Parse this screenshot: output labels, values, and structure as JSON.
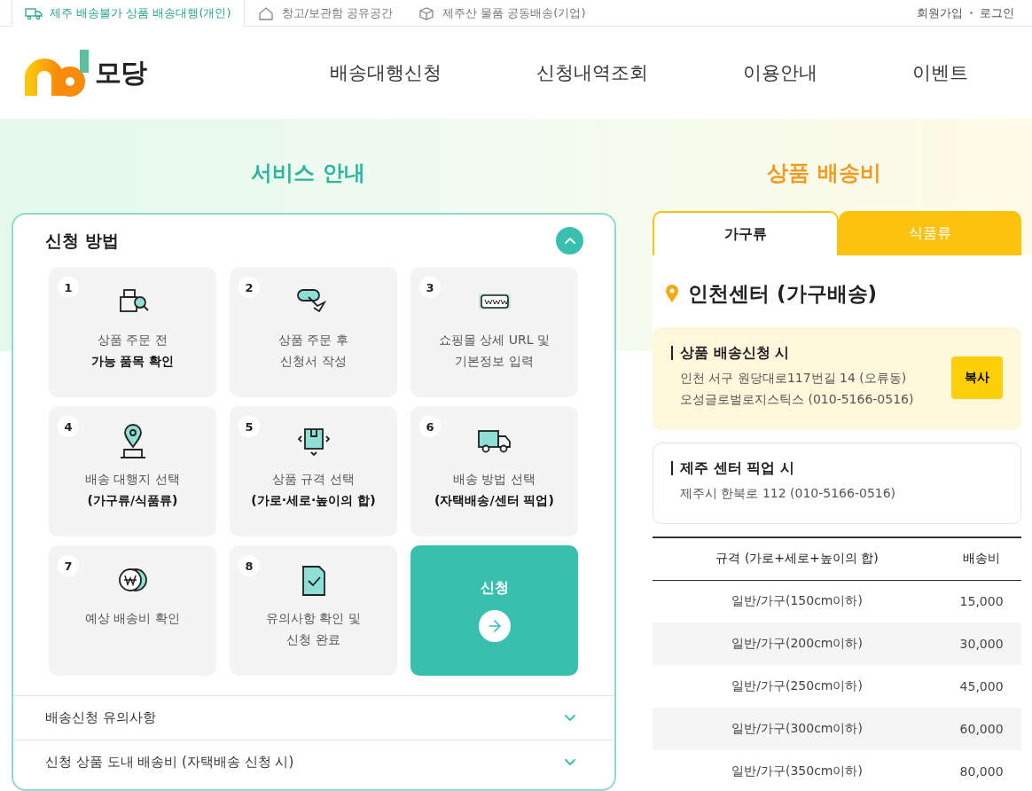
{
  "top_tabs": [
    {
      "label": "제주 배송불가 상품 배송대행(개인)",
      "selected": true
    },
    {
      "label": "창고/보관함 공유공간",
      "selected": false
    },
    {
      "label": "제주산 물품 공동배송(기업)",
      "selected": false
    }
  ],
  "account_links": [
    "회원가입",
    "로그인"
  ],
  "logo": {
    "text": "모당"
  },
  "nav": [
    "배송대행신청",
    "신청내역조회",
    "이용안내",
    "이벤트"
  ],
  "service": {
    "title": "서비스 안내",
    "sections": [
      {
        "title": "신청 방법",
        "expanded": true,
        "steps": [
          {
            "kind": "step",
            "number": "1",
            "text": "상품 주문 전\n**가능 품목 확인**"
          },
          {
            "kind": "step",
            "number": "2",
            "text": "상품 주문 후\n신청서 작성"
          },
          {
            "kind": "step",
            "number": "3",
            "text": "쇼핑몰 상세 URL 및\n기본정보 입력"
          },
          {
            "kind": "step",
            "number": "4",
            "text": "배송 대행지 선택\n**(가구류/식품류)**"
          },
          {
            "kind": "step",
            "number": "5",
            "text": "상품 규격 선택\n**(가로·세로·높이의 합)**"
          },
          {
            "kind": "step",
            "number": "6",
            "text": "배송 방법 선택\n**(자택배송/센터 픽업)**"
          },
          {
            "kind": "step",
            "number": "7",
            "text": "예상 배송비 확인"
          },
          {
            "kind": "step",
            "number": "8",
            "text": "유의사항 확인 및\n신청 완료"
          },
          {
            "kind": "action",
            "text": "신청"
          }
        ]
      },
      {
        "title": "배송신청 유의사항",
        "expanded": false
      },
      {
        "title": "신청 상품 도내 배송비 (자택배송 신청 시)",
        "expanded": false
      }
    ]
  },
  "fees": {
    "title": "상품 배송비",
    "tabs": [
      {
        "label": "가구류",
        "selected": true
      },
      {
        "label": "식품류",
        "selected": false
      }
    ],
    "center": "인천센터 (가구배송)",
    "addresses": [
      {
        "title": "상품 배송신청 시",
        "lines": [
          "인천 서구 원당대로117번길 14 (오류동)",
          "오성글로벌로지스틱스 (010-5166-0516)"
        ],
        "button": "복사"
      },
      {
        "title": "제주 센터 픽업 시",
        "lines": [
          "제주시 한북로 112 (010-5166-0516)"
        ]
      }
    ],
    "table": {
      "columns": [
        "규격 (가로+세로+높이의 합)",
        "배송비"
      ],
      "rows": [
        [
          "일반/가구(150cm이하)",
          "15,000"
        ],
        [
          "일반/가구(200cm이하)",
          "30,000"
        ],
        [
          "일반/가구(250cm이하)",
          "45,000"
        ],
        [
          "일반/가구(300cm이하)",
          "60,000"
        ],
        [
          "일반/가구(350cm이하)",
          "80,000"
        ]
      ]
    }
  }
}
